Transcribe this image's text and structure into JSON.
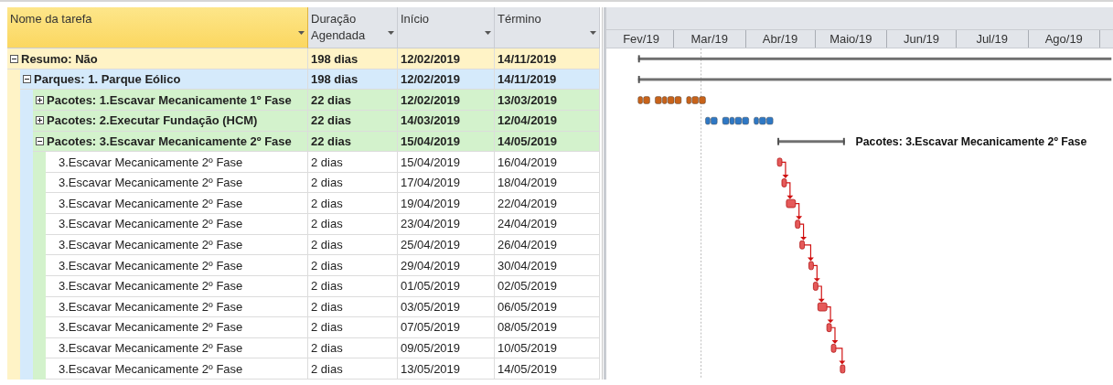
{
  "columns": [
    {
      "label": "Nome da tarefa",
      "selected": true
    },
    {
      "label": "Duração Agendada",
      "selected": false
    },
    {
      "label": "Início",
      "selected": false
    },
    {
      "label": "Término",
      "selected": false
    }
  ],
  "timescale": {
    "months": [
      "Fev/19",
      "Mar/19",
      "Abr/19",
      "Maio/19",
      "Jun/19",
      "Jul/19",
      "Ago/19"
    ]
  },
  "tasks": [
    {
      "kind": "summary",
      "name": "Resumo: Não",
      "duration": "198 dias",
      "start": "12/02/2019",
      "finish": "14/11/2019",
      "expanded": true,
      "children": [
        {
          "kind": "summary",
          "name": "Parques: 1. Parque Eólico",
          "duration": "198 dias",
          "start": "12/02/2019",
          "finish": "14/11/2019",
          "expanded": true,
          "children": [
            {
              "kind": "summary",
              "name": "Pacotes: 1.Escavar Mecanicamente 1º Fase",
              "duration": "22 dias",
              "start": "12/02/2019",
              "finish": "13/03/2019",
              "expanded": false,
              "color": "#c8631a"
            },
            {
              "kind": "summary",
              "name": "Pacotes: 2.Executar Fundação (HCM)",
              "duration": "22 dias",
              "start": "14/03/2019",
              "finish": "12/04/2019",
              "expanded": false,
              "color": "#2f78c4"
            },
            {
              "kind": "summary",
              "name": "Pacotes: 3.Escavar Mecanicamente 2º Fase",
              "duration": "22 dias",
              "start": "15/04/2019",
              "finish": "14/05/2019",
              "expanded": true,
              "bar_label": "Pacotes: 3.Escavar Mecanicamente 2º Fase",
              "children": [
                {
                  "kind": "task",
                  "name": "3.Escavar Mecanicamente 2º Fase",
                  "duration": "2 dias",
                  "start": "15/04/2019",
                  "finish": "16/04/2019"
                },
                {
                  "kind": "task",
                  "name": "3.Escavar Mecanicamente 2º Fase",
                  "duration": "2 dias",
                  "start": "17/04/2019",
                  "finish": "18/04/2019"
                },
                {
                  "kind": "task",
                  "name": "3.Escavar Mecanicamente 2º Fase",
                  "duration": "2 dias",
                  "start": "19/04/2019",
                  "finish": "22/04/2019"
                },
                {
                  "kind": "task",
                  "name": "3.Escavar Mecanicamente 2º Fase",
                  "duration": "2 dias",
                  "start": "23/04/2019",
                  "finish": "24/04/2019"
                },
                {
                  "kind": "task",
                  "name": "3.Escavar Mecanicamente 2º Fase",
                  "duration": "2 dias",
                  "start": "25/04/2019",
                  "finish": "26/04/2019"
                },
                {
                  "kind": "task",
                  "name": "3.Escavar Mecanicamente 2º Fase",
                  "duration": "2 dias",
                  "start": "29/04/2019",
                  "finish": "30/04/2019"
                },
                {
                  "kind": "task",
                  "name": "3.Escavar Mecanicamente 2º Fase",
                  "duration": "2 dias",
                  "start": "01/05/2019",
                  "finish": "02/05/2019"
                },
                {
                  "kind": "task",
                  "name": "3.Escavar Mecanicamente 2º Fase",
                  "duration": "2 dias",
                  "start": "03/05/2019",
                  "finish": "06/05/2019"
                },
                {
                  "kind": "task",
                  "name": "3.Escavar Mecanicamente 2º Fase",
                  "duration": "2 dias",
                  "start": "07/05/2019",
                  "finish": "08/05/2019"
                },
                {
                  "kind": "task",
                  "name": "3.Escavar Mecanicamente 2º Fase",
                  "duration": "2 dias",
                  "start": "09/05/2019",
                  "finish": "10/05/2019"
                },
                {
                  "kind": "task",
                  "name": "3.Escavar Mecanicamente 2º Fase",
                  "duration": "2 dias",
                  "start": "13/05/2019",
                  "finish": "14/05/2019"
                }
              ]
            }
          ]
        }
      ]
    }
  ]
}
